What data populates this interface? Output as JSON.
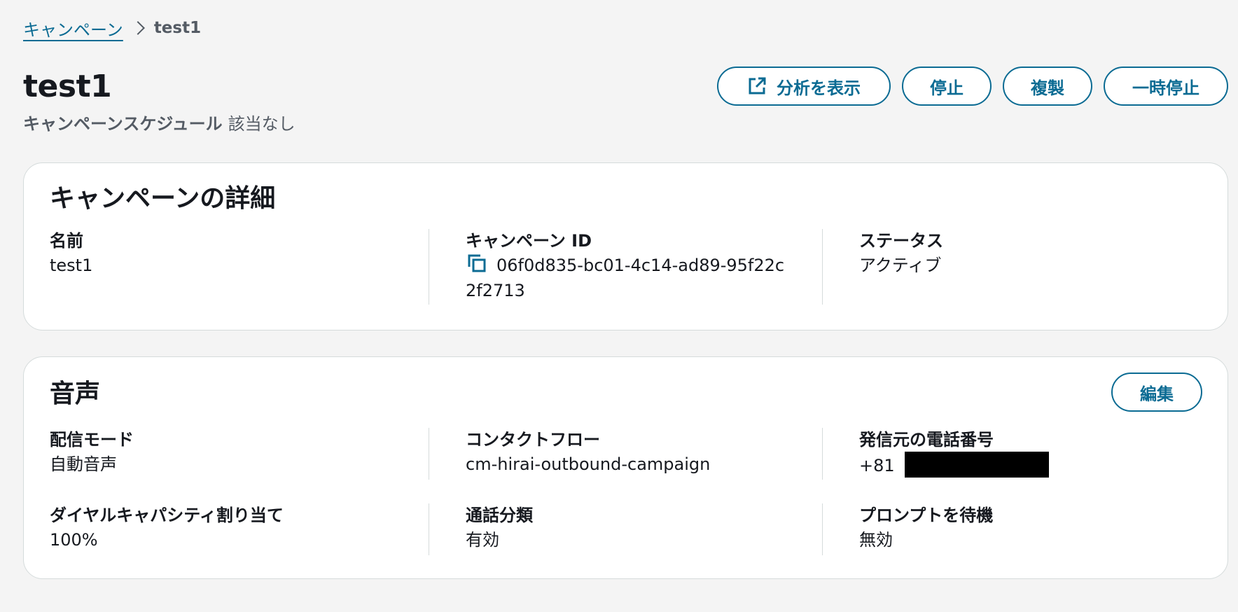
{
  "breadcrumb": {
    "parent": "キャンペーン",
    "current": "test1"
  },
  "page": {
    "title": "test1",
    "schedule_label": "キャンペーンスケジュール",
    "schedule_value": "該当なし"
  },
  "actions": {
    "view_analytics": "分析を表示",
    "stop": "停止",
    "duplicate": "複製",
    "pause": "一時停止"
  },
  "details": {
    "title": "キャンペーンの詳細",
    "name_label": "名前",
    "name_value": "test1",
    "id_label": "キャンペーン ID",
    "id_value": "06f0d835-bc01-4c14-ad89-95f22c2f2713",
    "status_label": "ステータス",
    "status_value": "アクティブ"
  },
  "voice": {
    "title": "音声",
    "edit": "編集",
    "delivery_mode_label": "配信モード",
    "delivery_mode_value": "自動音声",
    "contact_flow_label": "コンタクトフロー",
    "contact_flow_value": "cm-hirai-outbound-campaign",
    "source_phone_label": "発信元の電話番号",
    "source_phone_prefix": "+81",
    "dial_capacity_label": "ダイヤルキャパシティ割り当て",
    "dial_capacity_value": "100%",
    "call_classification_label": "通話分類",
    "call_classification_value": "有効",
    "await_prompt_label": "プロンプトを待機",
    "await_prompt_value": "無効"
  },
  "colors": {
    "accent": "#0b6b93",
    "border": "#d5dbdb",
    "background": "#f4f4f4"
  }
}
